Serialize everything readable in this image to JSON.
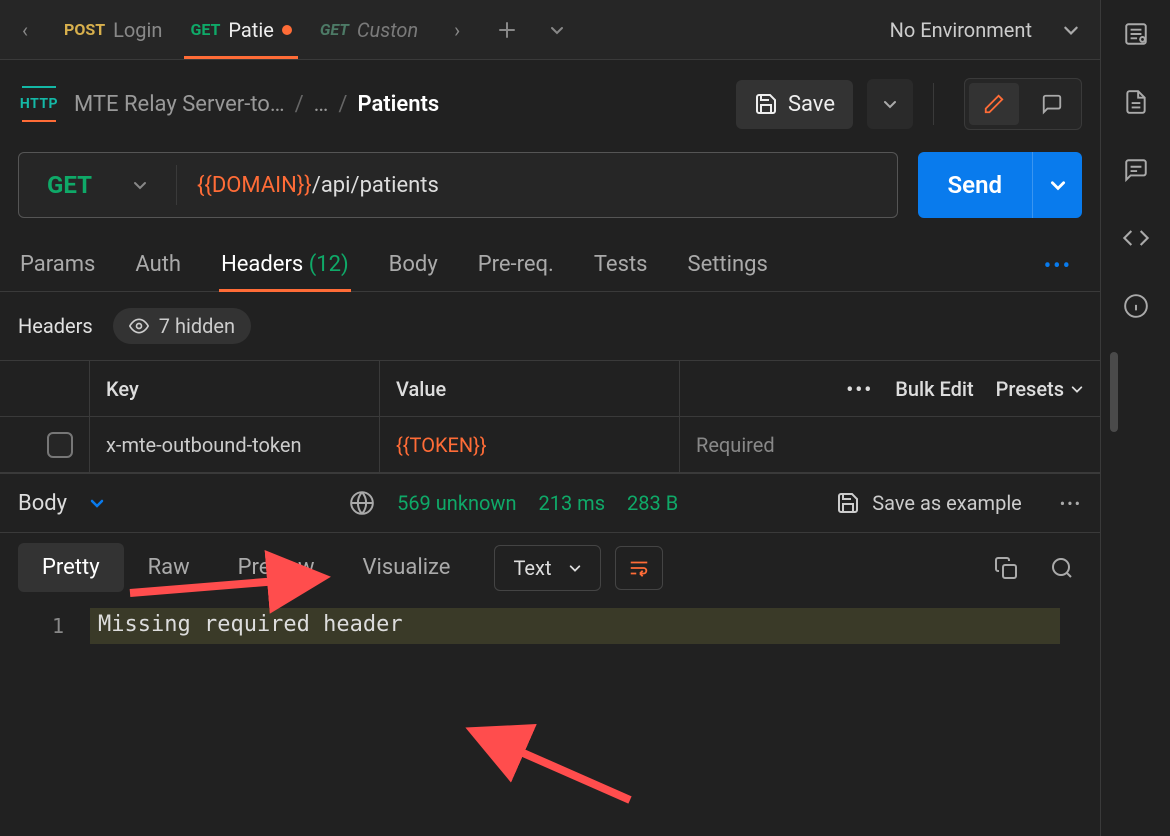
{
  "tabs": [
    {
      "method": "POST",
      "title": "Login"
    },
    {
      "method": "GET",
      "title": "Patie",
      "active": true,
      "dirty": true
    },
    {
      "method": "GET",
      "title": "Custon",
      "faded": true
    }
  ],
  "environment": "No Environment",
  "breadcrumb": {
    "root": "MTE Relay Server-to…",
    "mid": "…",
    "current": "Patients"
  },
  "save_label": "Save",
  "method": "GET",
  "url_var": "{{DOMAIN}}",
  "url_path": "/api/patients",
  "send_label": "Send",
  "request_tabs": {
    "params": "Params",
    "auth": "Auth",
    "headers": "Headers",
    "headers_count": "(12)",
    "body": "Body",
    "prereq": "Pre-req.",
    "tests": "Tests",
    "settings": "Settings"
  },
  "headers_section": {
    "title": "Headers",
    "hidden": "7 hidden",
    "key_label": "Key",
    "value_label": "Value",
    "bulk_edit": "Bulk Edit",
    "presets": "Presets",
    "row": {
      "key": "x-mte-outbound-token",
      "value": "{{TOKEN}}",
      "desc_placeholder": "Required"
    }
  },
  "response": {
    "label": "Body",
    "status": "569 unknown",
    "time": "213 ms",
    "size": "283 B",
    "save_example": "Save as example"
  },
  "body_view": {
    "pretty": "Pretty",
    "raw": "Raw",
    "preview": "Preview",
    "visualize": "Visualize",
    "format": "Text",
    "line_no": "1",
    "content": "Missing required header"
  }
}
